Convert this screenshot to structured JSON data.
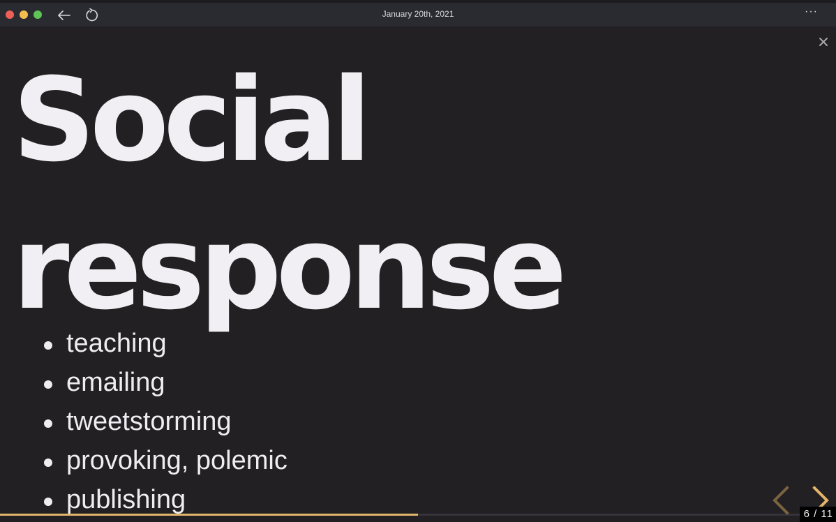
{
  "window": {
    "title": "January 20th, 2021",
    "more_label": "···"
  },
  "slide": {
    "heading_line1": "Social",
    "heading_line2": "response",
    "bullets": [
      "teaching",
      "emailing",
      "tweetstorming",
      "provoking, polemic",
      "publishing"
    ]
  },
  "presentation": {
    "current_slide": 6,
    "total_slides": 11,
    "counter_separator": "/",
    "progress_fraction": 0.5,
    "accent_color": "#e2b56a",
    "dim_arrow_color": "#7a6440"
  },
  "icons": {
    "back": "arrow-left-icon",
    "reload": "reload-icon",
    "close": "close-icon",
    "prev": "chevron-left-icon",
    "next": "chevron-right-icon"
  }
}
